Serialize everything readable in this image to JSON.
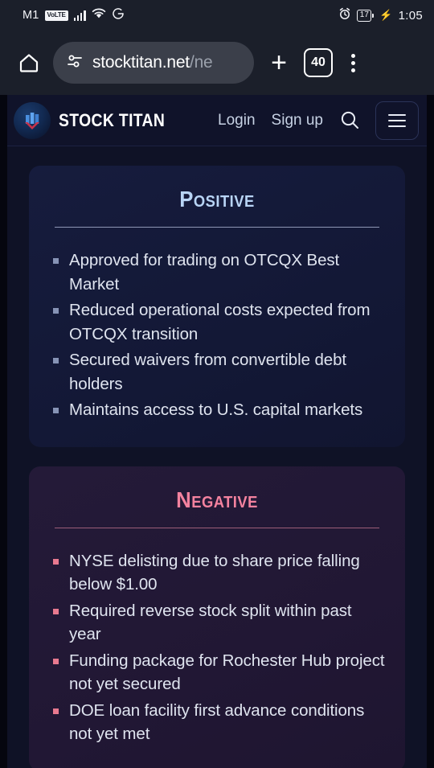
{
  "statusbar": {
    "carrier": "M1",
    "volte_badge": "VoLTE",
    "alarm_icon": "alarm-clock-icon",
    "battery_level": "17",
    "charging_icon": "charging-bolt-icon",
    "time": "1:05"
  },
  "browser": {
    "home_icon": "home-icon",
    "site_settings_icon": "tune-sliders-icon",
    "url_main": "stocktitan.net",
    "url_dim": "/ne",
    "new_tab_label": "+",
    "tab_count": "40",
    "overflow_icon": "three-dot-menu-icon"
  },
  "site_header": {
    "logo_icon": "stock-titan-logo-icon",
    "brand": "STOCK TITAN",
    "login_label": "Login",
    "signup_label": "Sign up",
    "search_icon": "search-icon",
    "menu_icon": "hamburger-menu-icon"
  },
  "cards": [
    {
      "id": "positive",
      "title": "Positive",
      "accent": "#b8d4f5",
      "items": [
        "Approved for trading on OTCQX Best Market",
        "Reduced operational costs expected from OTCQX transition",
        "Secured waivers from convertible debt holders",
        "Maintains access to U.S. capital markets"
      ]
    },
    {
      "id": "negative",
      "title": "Negative",
      "accent": "#f4829f",
      "items": [
        "NYSE delisting due to share price falling below $1.00",
        "Required reverse stock split within past year",
        "Funding package for Rochester Hub project not yet secured",
        "DOE loan facility first advance conditions not yet met"
      ]
    }
  ]
}
